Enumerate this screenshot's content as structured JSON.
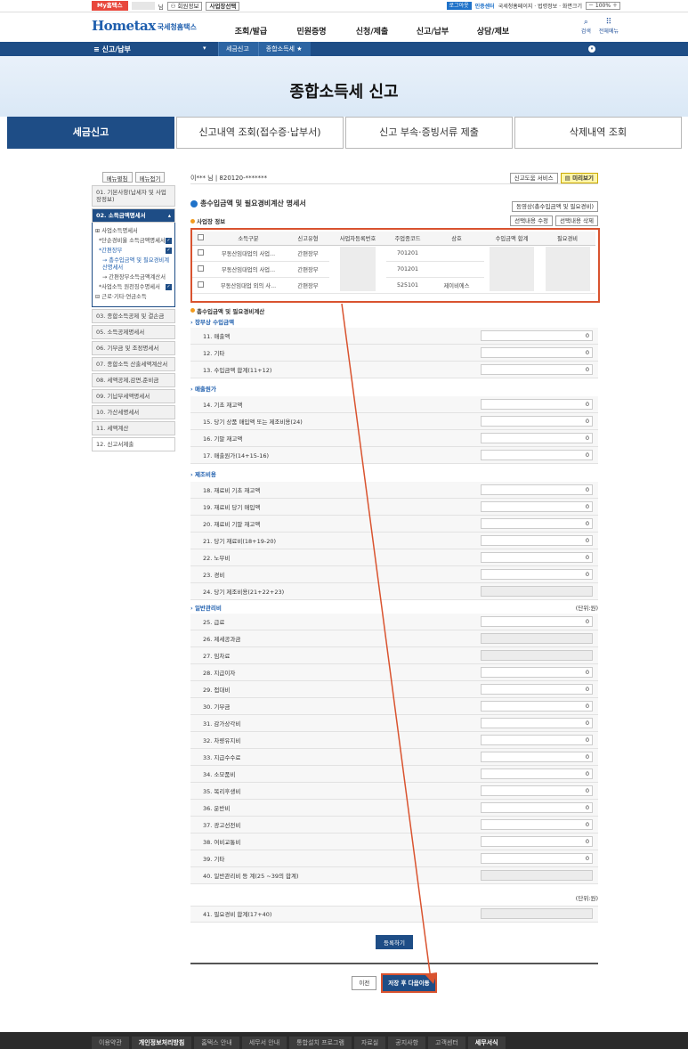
{
  "topbar": {
    "my": "My홈택스",
    "user_suffix": "님",
    "user_info": "회원정보",
    "select": "사업장선택",
    "logout": "로그아웃",
    "cert": "인증센터",
    "links": "국세청홈페이지 · 법령정보 · 화면크기",
    "zoom": "100%"
  },
  "header": {
    "logo_small": "국세청 홈택스",
    "logo_home": "Hometax",
    "logo_sub": "국세청홈택스",
    "menu": [
      "조회/발급",
      "민원증명",
      "신청/제출",
      "신고/납부",
      "상담/제보"
    ],
    "search": "검색",
    "all_menu": "전체메뉴"
  },
  "nav": {
    "category": "신고/납부",
    "crumbs": [
      "세금신고",
      "종합소득세"
    ]
  },
  "banner": {
    "title": "종합소득세 신고"
  },
  "tabs": [
    "세금신고",
    "신고내역 조회(접수증·납부서)",
    "신고 부속·증빙서류 제출",
    "삭제내역 조회"
  ],
  "side": {
    "expand": "메뉴펼침",
    "collapse": "메뉴접기",
    "items_before": [
      "01. 기본사항(납세자 및 사업장정보)"
    ],
    "active": "02. 소득금액명세서",
    "sub": [
      "사업소득명세서",
      "*단순경비율 소득금액명세서",
      "*간편장부",
      "→ 총수입금액 및 필요경비계산명세서",
      "→ 간편장부소득금액계산서",
      "*사업소득 원천징수명세서",
      "근로·기타·연금소득"
    ],
    "items_after": [
      "03. 종합소득공제 및 결손금",
      "05. 소득공제명세서",
      "06. 기부금 및 조정명세서",
      "07. 종합소득 산출세액계산서",
      "08. 세액공제,감면,준비금",
      "09. 기납부세액명세서",
      "10. 가산세명세서",
      "11. 세액계산",
      "12. 신고서제출"
    ]
  },
  "main": {
    "user": "이*** 님 | 820120-*******",
    "help": "신고도움 서비스",
    "preview": "미리보기",
    "section_title": "총수입금액 및 필요경비계산 명세서",
    "video": "동영상(총수입금액 및 필요경비)",
    "biz_info": "사업장 정보",
    "edit": "선택내용 수정",
    "delete": "선택내용 삭제",
    "table_headers": [
      "소득구분",
      "신고유형",
      "사업자등록번호",
      "주업종코드",
      "상호",
      "수입금액 합계",
      "필요경비"
    ],
    "rows": [
      {
        "kind": "부동산임대업의 사업...",
        "type": "간편장부",
        "code": "701201",
        "name": ""
      },
      {
        "kind": "부동산임대업의 사업...",
        "type": "간편장부",
        "code": "701201",
        "name": ""
      },
      {
        "kind": "부동산임대업 외의 사...",
        "type": "간편장부",
        "code": "525101",
        "name": "제이비에스"
      }
    ],
    "calc_title": "총수입금액 및 필요경비계산",
    "g1": "장부상 수입금액",
    "g1_rows": [
      [
        "11. 매출액",
        "0"
      ],
      [
        "12. 기타",
        "0"
      ],
      [
        "13. 수입금액 합계(11+12)",
        "0"
      ]
    ],
    "g2": "매출원가",
    "g2_rows": [
      [
        "14. 기초 재고액",
        "0"
      ],
      [
        "15. 당기 상품 매입액 또는 제조비용(24)",
        "0"
      ],
      [
        "16. 기말 재고액",
        "0"
      ],
      [
        "17. 매출원가(14+15-16)",
        "0"
      ]
    ],
    "g3": "제조비용",
    "g3_rows": [
      [
        "18. 재료비 기초 재고액",
        "0"
      ],
      [
        "19. 재료비 당기 매입액",
        "0"
      ],
      [
        "20. 재료비 기말 재고액",
        "0"
      ],
      [
        "21. 당기 재료비(18+19-20)",
        "0"
      ],
      [
        "22. 노무비",
        "0"
      ],
      [
        "23. 경비",
        "0"
      ],
      [
        "24. 당기 제조비용(21+22+23)",
        ""
      ]
    ],
    "g4": "일반관리비",
    "unit": "(단위:원)",
    "g4_rows": [
      [
        "25. 급료",
        "0"
      ],
      [
        "26. 제세공과금",
        ""
      ],
      [
        "27. 임차료",
        ""
      ],
      [
        "28. 지급이자",
        "0"
      ],
      [
        "29. 접대비",
        "0"
      ],
      [
        "30. 기부금",
        "0"
      ],
      [
        "31. 감가상각비",
        "0"
      ],
      [
        "32. 차량유지비",
        "0"
      ],
      [
        "33. 지급수수료",
        "0"
      ],
      [
        "34. 소모품비",
        "0"
      ],
      [
        "35. 복리후생비",
        "0"
      ],
      [
        "36. 운반비",
        "0"
      ],
      [
        "37. 광고선전비",
        "0"
      ],
      [
        "38. 여비교통비",
        "0"
      ],
      [
        "39. 기타",
        "0"
      ],
      [
        "40. 일반관리비 등 계(25 ~39의 합계)",
        ""
      ]
    ],
    "unit2": "(단위:원)",
    "total": [
      "41. 필요경비 합계(17+40)",
      ""
    ],
    "register": "등록하기",
    "prev": "이전",
    "next": "저장 후 다음이동"
  },
  "footer": [
    "이용약관",
    "개인정보처리방침",
    "홈택스 안내",
    "세무서 안내",
    "통합설치 프로그램",
    "자료실",
    "공지사항",
    "고객센터",
    "세무서식"
  ]
}
